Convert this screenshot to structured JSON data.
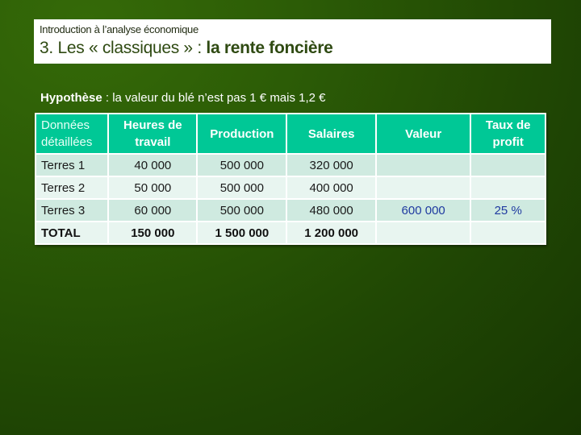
{
  "header": {
    "subtitle": "Introduction à l’analyse économique",
    "title_prefix": "3. Les « classiques » : ",
    "title_bold": "la rente foncière"
  },
  "hypothesis": {
    "label": "Hypothèse",
    "text": " : la valeur du blé n’est pas 1 € mais 1,2 €"
  },
  "table": {
    "headers": [
      "Données détaillées",
      "Heures de travail",
      "Production",
      "Salaires",
      "Valeur",
      "Taux de profit"
    ],
    "rows": [
      [
        "Terres 1",
        "40 000",
        "500 000",
        "320 000",
        "",
        ""
      ],
      [
        "Terres 2",
        "50 000",
        "500 000",
        "400 000",
        "",
        ""
      ],
      [
        "Terres 3",
        "60 000",
        "500 000",
        "480 000",
        "600 000",
        "25 %"
      ],
      [
        "TOTAL",
        "150 000",
        "1 500 000",
        "1 200 000",
        "",
        ""
      ]
    ]
  },
  "colors": {
    "background": "#2c5c06",
    "table_header": "#00c896",
    "row_odd": "#cfeae0",
    "row_even": "#e8f5f0",
    "highlight_text": "#1f3aa0"
  }
}
